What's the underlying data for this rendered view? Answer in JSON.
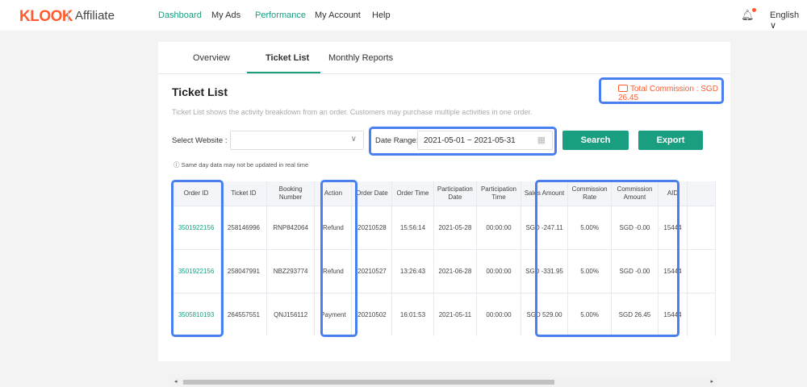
{
  "header": {
    "logo": "KLOOK",
    "product": "Affiliate",
    "nav": [
      {
        "label": "Dashboard"
      },
      {
        "label": "My Ads"
      },
      {
        "label": "Performance"
      },
      {
        "label": "My Account"
      },
      {
        "label": "Help"
      }
    ],
    "language": "English ∨"
  },
  "tabs": [
    {
      "label": "Overview"
    },
    {
      "label": "Ticket List"
    },
    {
      "label": "Monthly Reports"
    }
  ],
  "page": {
    "title": "Ticket List",
    "total_commission": "Total Commission : SGD 26.45",
    "description": "Ticket List shows the activity breakdown from an order. Customers may purchase multiple activities in one order.",
    "note": "ⓘ Same day data may not be updated in real time"
  },
  "filters": {
    "website_label": "Select Website :",
    "website_value": "",
    "date_label": "Date Range:",
    "date_value": "2021-05-01 ~ 2021-05-31",
    "search": "Search",
    "export": "Export"
  },
  "table": {
    "columns": [
      "Order ID",
      "Ticket ID",
      "Booking Number",
      "Action",
      "Order Date",
      "Order Time",
      "Participation Date",
      "Participation Time",
      "Sales Amount",
      "Commission Rate",
      "Commission Amount",
      "AID",
      ""
    ],
    "rows": [
      [
        "3501922156",
        "258146996",
        "RNP842064",
        "Refund",
        "20210528",
        "15:56:14",
        "2021-05-28",
        "00:00:00",
        "SGD -247.11",
        "5.00%",
        "SGD -0.00",
        "15444",
        ""
      ],
      [
        "3501922156",
        "258047991",
        "NBZ293774",
        "Refund",
        "20210527",
        "13:26:43",
        "2021-06-28",
        "00:00:00",
        "SGD -331.95",
        "5.00%",
        "SGD -0.00",
        "15444",
        ""
      ],
      [
        "3505810193",
        "264557551",
        "QNJ156112",
        "Payment",
        "20210502",
        "16:01:53",
        "2021-05-11",
        "00:00:00",
        "SGD 529.00",
        "5.00%",
        "SGD 26.45",
        "15444",
        ""
      ]
    ]
  }
}
